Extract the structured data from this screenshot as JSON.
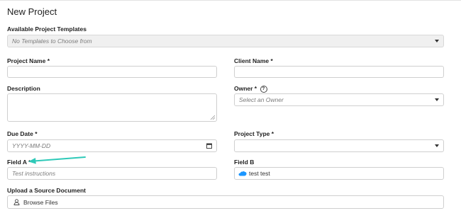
{
  "page": {
    "title": "New Project"
  },
  "form": {
    "templates": {
      "label": "Available Project Templates",
      "placeholder": "No Templates to Choose from"
    },
    "project_name": {
      "label": "Project Name *",
      "value": ""
    },
    "client_name": {
      "label": "Client Name *",
      "value": ""
    },
    "description": {
      "label": "Description",
      "value": ""
    },
    "owner": {
      "label": "Owner *",
      "placeholder": "Select an Owner"
    },
    "due_date": {
      "label": "Due Date *",
      "placeholder": "YYYY-MM-DD"
    },
    "project_type": {
      "label": "Project Type *",
      "value": ""
    },
    "field_a": {
      "label": "Field A *",
      "placeholder": "Test instructions"
    },
    "field_b": {
      "label": "Field B",
      "value": "test test",
      "icon": "salesforce-cloud-icon"
    },
    "upload": {
      "label": "Upload a Source Document",
      "button_label": "Browse Files",
      "icon": "upload-icon"
    }
  },
  "colors": {
    "annotation_arrow": "#2ec9b8",
    "cloud_icon": "#1b96ff"
  }
}
